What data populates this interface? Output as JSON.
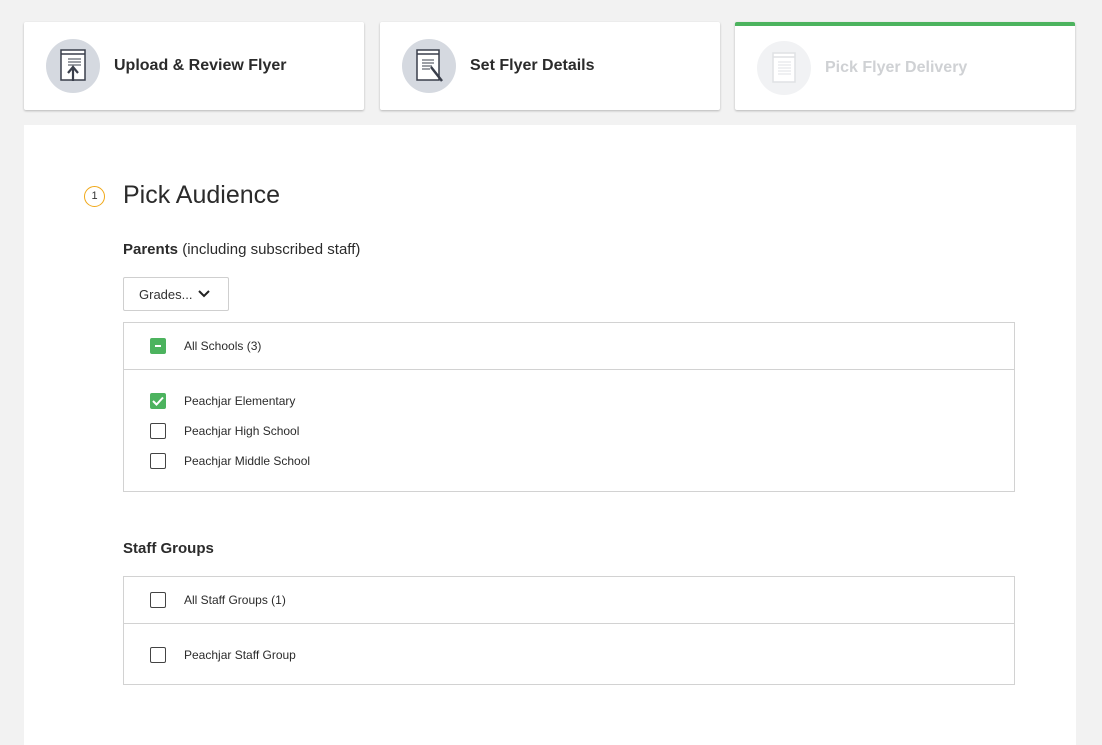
{
  "steps": [
    {
      "label": "Upload & Review Flyer",
      "icon": "upload-flyer-icon"
    },
    {
      "label": "Set Flyer Details",
      "icon": "flyer-details-icon"
    },
    {
      "label": "Pick Flyer Delivery",
      "icon": "flyer-delivery-icon",
      "active": true
    }
  ],
  "audience": {
    "step_number": "1",
    "title": "Pick Audience",
    "parents_bold": "Parents",
    "parents_note": "(including subscribed staff)",
    "grades_button": "Grades...",
    "schools": {
      "all_label": "All Schools (3)",
      "all_state": "partial",
      "items": [
        {
          "label": "Peachjar Elementary",
          "checked": true
        },
        {
          "label": "Peachjar High School",
          "checked": false
        },
        {
          "label": "Peachjar Middle School",
          "checked": false
        }
      ]
    },
    "staff": {
      "heading": "Staff Groups",
      "all_label": "All Staff Groups (1)",
      "all_state": "unchecked",
      "items": [
        {
          "label": "Peachjar Staff Group",
          "checked": false
        }
      ]
    }
  },
  "colors": {
    "accent_green": "#4cb35e",
    "badge_orange": "#f0a818"
  }
}
